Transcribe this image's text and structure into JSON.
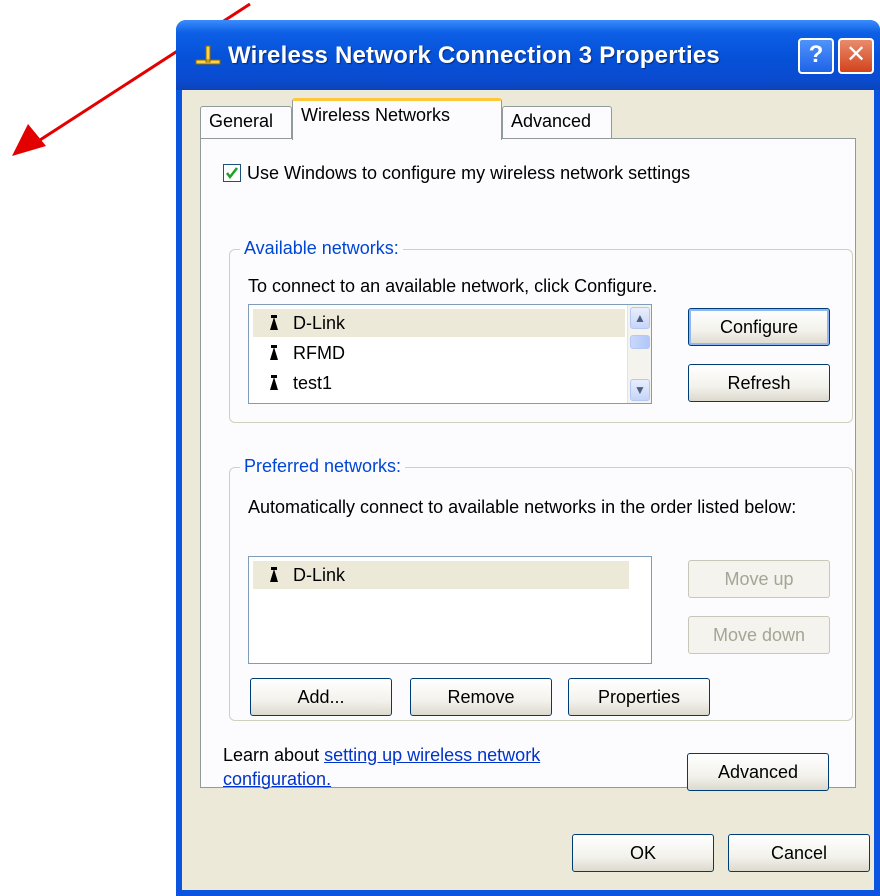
{
  "window": {
    "title": "Wireless Network Connection 3 Properties",
    "help_label": "?",
    "close_label": "✕"
  },
  "tabs": [
    {
      "label": "General"
    },
    {
      "label": "Wireless Networks"
    },
    {
      "label": "Advanced"
    }
  ],
  "use_windows_checkbox": {
    "label": "Use Windows to configure my wireless network settings",
    "checked": true
  },
  "available": {
    "title": "Available networks:",
    "description": "To connect to an available network, click Configure.",
    "networks": [
      "D-Link",
      "RFMD",
      "test1"
    ],
    "configure_label": "Configure",
    "refresh_label": "Refresh"
  },
  "preferred": {
    "title": "Preferred networks:",
    "description": "Automatically connect to available networks in the order listed below:",
    "networks": [
      "D-Link"
    ],
    "move_up_label": "Move up",
    "move_down_label": "Move down",
    "add_label": "Add...",
    "remove_label": "Remove",
    "properties_label": "Properties"
  },
  "learn": {
    "prefix": "Learn about ",
    "link": "setting up wireless network configuration."
  },
  "advanced_button_label": "Advanced",
  "ok_label": "OK",
  "cancel_label": "Cancel",
  "colors": {
    "titlebar": "#0551d8",
    "group_title": "#0046d5",
    "link": "#0033cc",
    "arrow": "#e30000"
  }
}
